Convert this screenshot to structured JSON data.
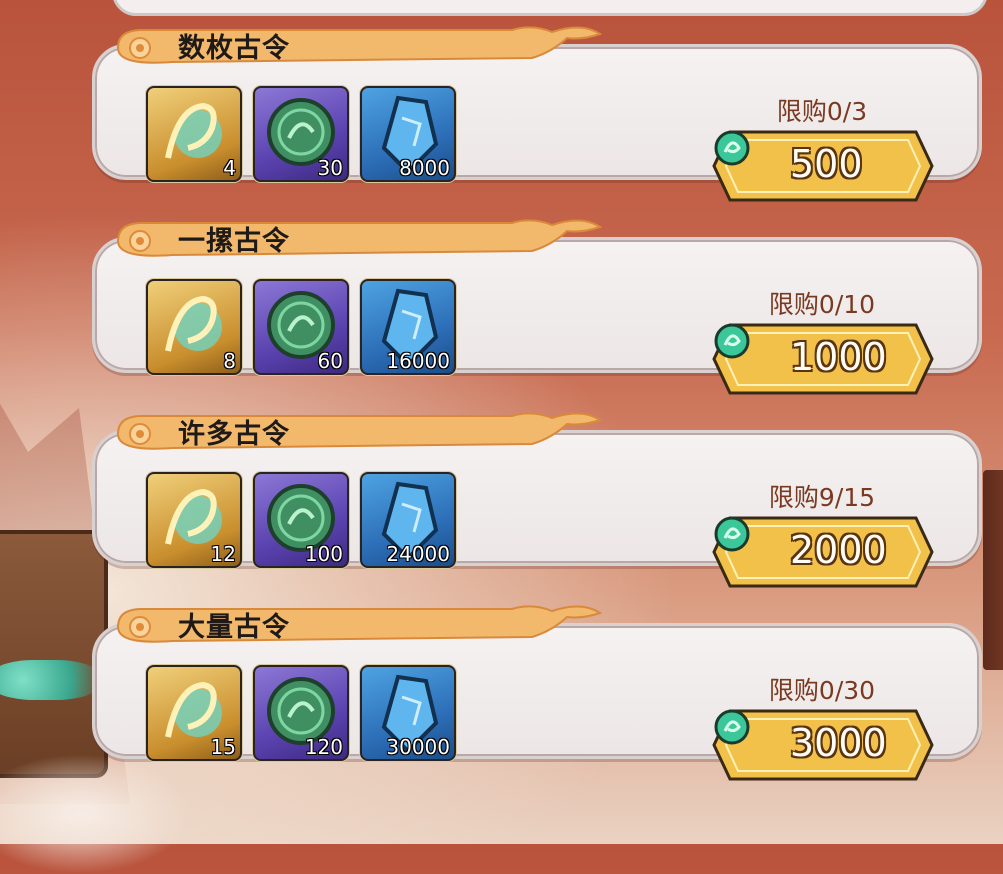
{
  "colors": {
    "banner": "#f2b86c",
    "button_gold": "#f2c14a",
    "limit_text": "#7a3a22",
    "jade": "#3cc79a"
  },
  "packs": [
    {
      "title": "数枚古令",
      "items": [
        {
          "icon": "golden-dragon-token-icon",
          "count": "4"
        },
        {
          "icon": "jade-coin-icon",
          "count": "30"
        },
        {
          "icon": "blue-crystal-icon",
          "count": "8000"
        }
      ],
      "limit": "限购0/3",
      "price": "500"
    },
    {
      "title": "一摞古令",
      "items": [
        {
          "icon": "golden-dragon-token-icon",
          "count": "8"
        },
        {
          "icon": "jade-coin-icon",
          "count": "60"
        },
        {
          "icon": "blue-crystal-icon",
          "count": "16000"
        }
      ],
      "limit": "限购0/10",
      "price": "1000"
    },
    {
      "title": "许多古令",
      "items": [
        {
          "icon": "golden-dragon-token-icon",
          "count": "12"
        },
        {
          "icon": "jade-coin-icon",
          "count": "100"
        },
        {
          "icon": "blue-crystal-icon",
          "count": "24000"
        }
      ],
      "limit": "限购9/15",
      "price": "2000"
    },
    {
      "title": "大量古令",
      "items": [
        {
          "icon": "golden-dragon-token-icon",
          "count": "15"
        },
        {
          "icon": "jade-coin-icon",
          "count": "120"
        },
        {
          "icon": "blue-crystal-icon",
          "count": "30000"
        }
      ],
      "limit": "限购0/30",
      "price": "3000"
    }
  ]
}
